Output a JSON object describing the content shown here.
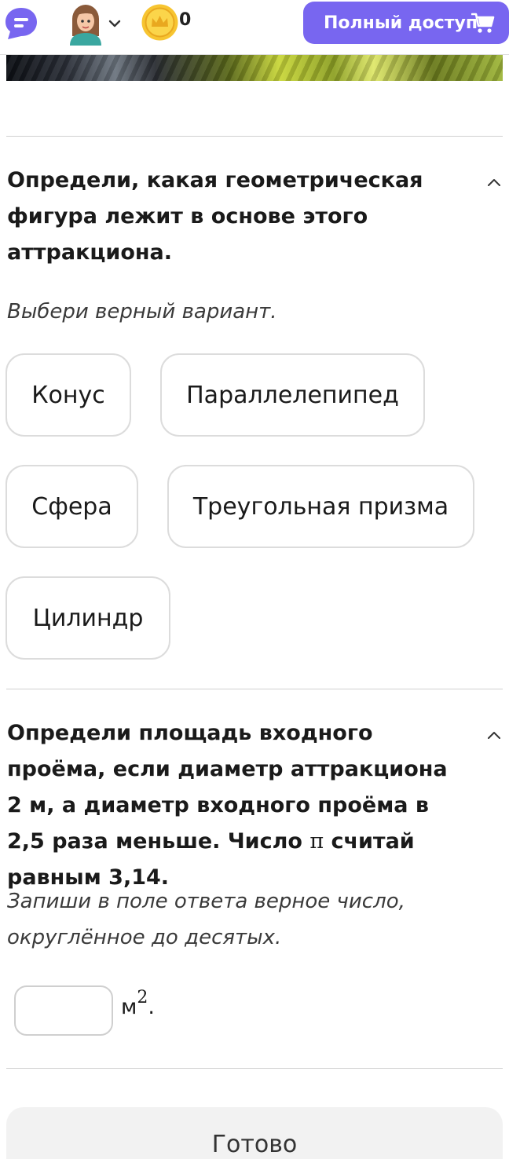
{
  "header": {
    "coins": "0",
    "full_access_label": "Полный доступ",
    "accent_color": "#7866f0"
  },
  "question1": {
    "title": "Определи, какая геометрическая фигура лежит в основе этого аттракциона.",
    "hint": "Выбери верный вариант.",
    "options": [
      "Конус",
      "Параллелепипед",
      "Сфера",
      "Треугольная призма",
      "Цилиндр"
    ]
  },
  "question2": {
    "title_part1": "Определи площадь входного проёма, если диаметр аттракциона 2 м, а диаметр входного проёма в 2,5 раза меньше. Число ",
    "pi": "π",
    "title_part2": " считай равным 3,14.",
    "hint": "Запиши в поле ответа верное число, округлённое до десятых.",
    "answer_value": "",
    "unit": "м",
    "unit_exp": "2",
    "unit_suffix": "."
  },
  "footer": {
    "done_label": "Готово"
  },
  "icons": {
    "logo": "chat-logo-icon",
    "avatar": "user-avatar-icon",
    "chevron": "chevron-down-icon",
    "coin": "crown-coin-icon",
    "cart": "cart-icon",
    "collapse": "chevron-up-icon"
  }
}
